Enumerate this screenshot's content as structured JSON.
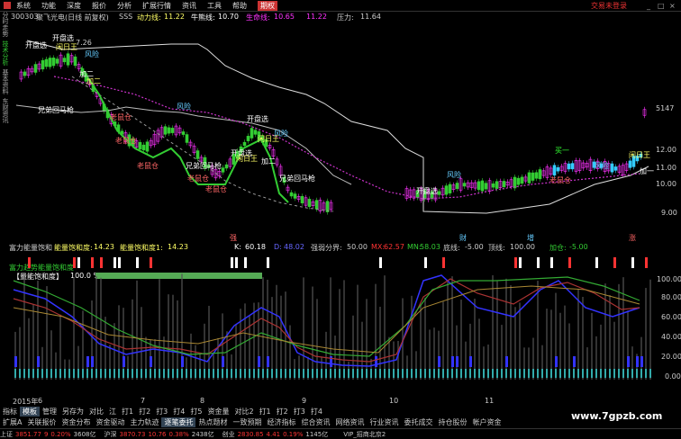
{
  "menu": {
    "items": [
      "系统",
      "功能",
      "深度",
      "报价",
      "分析",
      "扩展行情",
      "资讯",
      "工具",
      "帮助"
    ],
    "active_item": "期权",
    "trade_link": "交易未登录"
  },
  "sidebar": {
    "tabs": [
      "分时走势",
      "技术分析",
      "基本资料",
      "东财资讯"
    ]
  },
  "chart_header": {
    "code": "300303",
    "name": "聚飞光电(日线 前复权)",
    "formula": "SSS",
    "momentum_label": "动力线:",
    "momentum_value": "11.22",
    "bull_label": "牛熊线:",
    "bull_value": "10.70",
    "life_label": "生命线:",
    "life_value": "10.65",
    "extra_value": "11.22",
    "pressure_label": "压力:",
    "pressure_value": "11.64"
  },
  "price_axis": [
    "5147",
    "12.00",
    "11.00",
    "10.00",
    "9.00"
  ],
  "price_labels": [
    {
      "text": "开盘选",
      "color": "#fff"
    },
    {
      "text": "开盘选",
      "color": "#fff"
    },
    {
      "text": "闲日王",
      "color": "#ff6"
    },
    {
      "text": "7.26",
      "color": "#ccc"
    },
    {
      "text": "风险",
      "color": "#6cf"
    },
    {
      "text": "加二",
      "color": "#fff"
    },
    {
      "text": "加二",
      "color": "#ff6"
    },
    {
      "text": "兄弟回马枪",
      "color": "#fff"
    },
    {
      "text": "老鼠仓",
      "color": "#f66"
    },
    {
      "text": "老鼠仓",
      "color": "#f66"
    },
    {
      "text": "老鼠仓",
      "color": "#f66"
    },
    {
      "text": "风险",
      "color": "#6cf"
    },
    {
      "text": "开盘选",
      "color": "#fff"
    },
    {
      "text": "闲日王",
      "color": "#ff6"
    },
    {
      "text": "风险",
      "color": "#6cf"
    },
    {
      "text": "加二",
      "color": "#fff"
    },
    {
      "text": "开盘选",
      "color": "#fff"
    },
    {
      "text": "闲日王",
      "color": "#ff6"
    },
    {
      "text": "兄弟回马枪",
      "color": "#fff"
    },
    {
      "text": "老鼠仓",
      "color": "#f66"
    },
    {
      "text": "兄弟回马枪",
      "color": "#fff"
    },
    {
      "text": "老鼠仓",
      "color": "#f66"
    },
    {
      "text": "开盘选",
      "color": "#fff"
    },
    {
      "text": "风险",
      "color": "#6cf"
    },
    {
      "text": "老鼠仓",
      "color": "#f66"
    },
    {
      "text": "买一",
      "color": "#3f3"
    },
    {
      "text": "风险",
      "color": "#6cf"
    },
    {
      "text": "闲日王",
      "color": "#ff6"
    },
    {
      "text": "加一",
      "color": "#fff"
    }
  ],
  "mid_markers": {
    "weak": "强",
    "zhi": "财",
    "bei": "增",
    "tu": "涨"
  },
  "indicator_header": {
    "title": "富力能量饱和",
    "energy_label": "能量饱和度:",
    "energy_value": "14.23",
    "energy2_label": "能量饱和度1:",
    "energy2_value": "14.23",
    "k_label": "K:",
    "k_value": "60.18",
    "d_label": "D:",
    "d_value": "48.02",
    "strength_label": "强弱分界:",
    "strength_value": "50.00",
    "mx_label": "MX:",
    "mx_value": "62.57",
    "mn_label": "MN:",
    "mn_value": "58.03",
    "bottom_label": "底线:",
    "bottom_value": "-5.00",
    "top_label": "顶线:",
    "top_value": "100.00",
    "add_label": "加仓:",
    "add_value": "-5.00"
  },
  "indicator_sub": {
    "line1": "富力趋势能量饱和度",
    "line2": "【量能饱和度】",
    "line2_value": "100.0 %"
  },
  "indicator_axis": [
    "100.00",
    "80.00",
    "60.00",
    "40.00",
    "20.00",
    "0.00"
  ],
  "time_axis": {
    "year": "2015年",
    "months": [
      "6",
      "7",
      "8",
      "9",
      "10",
      "11"
    ]
  },
  "index_tabs": [
    "指标",
    "模板",
    "管理",
    "另存为",
    "对比",
    "江",
    "打1",
    "打2",
    "打3",
    "打4",
    "打5",
    "资金量",
    "对比2",
    "打1",
    "打2",
    "打3",
    "打4"
  ],
  "index_tab_selected": 1,
  "func_tabs": [
    "扩展A",
    "关联报价",
    "资金分布",
    "资金驱动",
    "主力轨迹",
    "逐笔委托",
    "热点题材",
    "一致预期",
    "经济指标",
    "综合资讯",
    "网络资讯",
    "行业资讯",
    "委托成交",
    "持仓股份",
    "帐户资金"
  ],
  "func_tab_selected": 5,
  "status": {
    "items": [
      {
        "label": "上证",
        "value": "3851.77",
        "change": "9",
        "pct": "0.20%",
        "amount": "3608亿",
        "color": "#f33"
      },
      {
        "label": "沪深",
        "value": "3870.73",
        "change": "10.76",
        "pct": "0.38%",
        "amount": "2438亿",
        "color": "#f33"
      },
      {
        "label": "创业",
        "value": "2830.85",
        "change": "4.41",
        "pct": "0.19%",
        "amount": "1145亿",
        "color": "#f33"
      }
    ],
    "account": "VIP_招商北京2"
  },
  "watermark": "www.7gpzb.com"
}
